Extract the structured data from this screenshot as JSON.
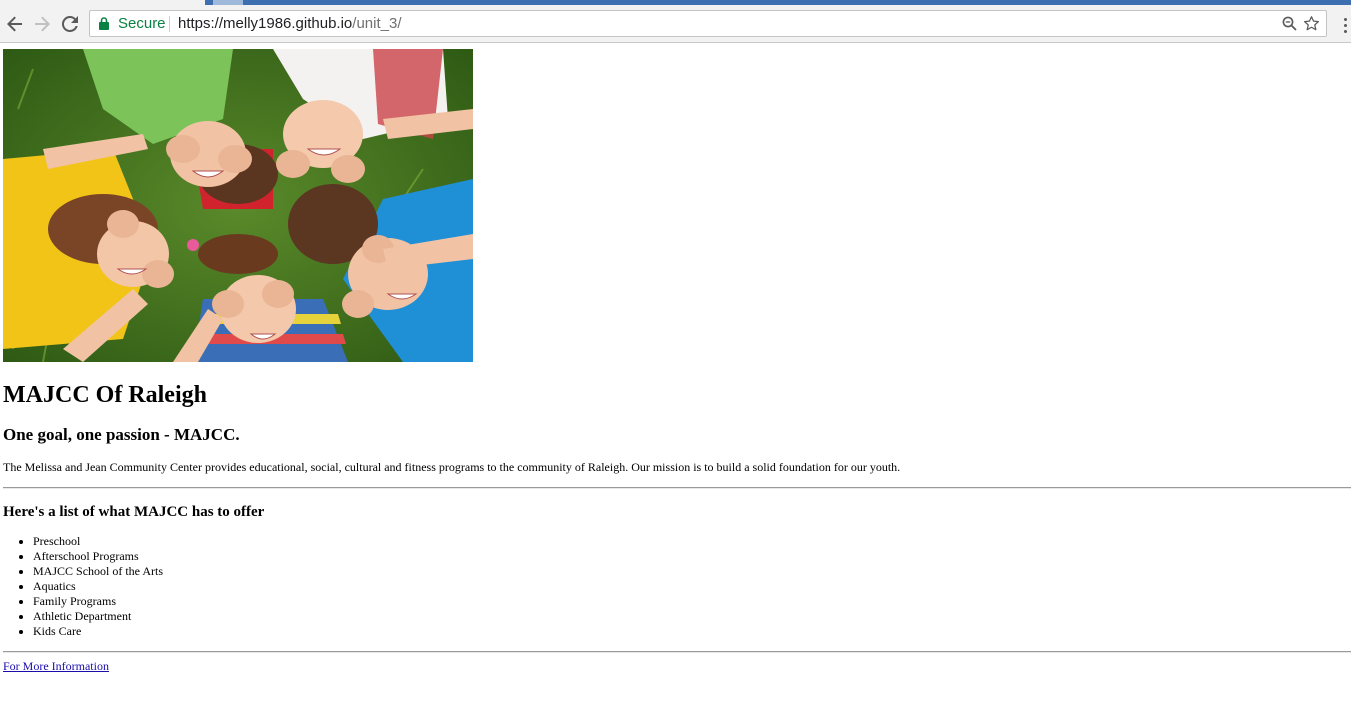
{
  "browser": {
    "secure_label": "Secure",
    "url_host": "https://melly1986.github.io",
    "url_path": "/unit_3/"
  },
  "page": {
    "title": "MAJCC Of Raleigh",
    "tagline": "One goal, one passion - MAJCC.",
    "description": "The Melissa and Jean Community Center provides educational, social, cultural and fitness programs to the community of Raleigh. Our mission is to build a solid foundation for our youth.",
    "offer_heading": "Here's a list of what MAJCC has to offer",
    "offers": [
      "Preschool",
      "Afterschool Programs",
      "MAJCC School of the Arts",
      "Aquatics",
      "Family Programs",
      "Athletic Department",
      "Kids Care"
    ],
    "more_link": "For More Information"
  },
  "colors": {
    "secure_green": "#0b8043",
    "link_blue": "#1a0dab",
    "tab_accent": "#3e6fb0"
  },
  "icons": [
    "back-arrow-icon",
    "forward-arrow-icon",
    "reload-icon",
    "lock-icon",
    "zoom-icon",
    "star-icon",
    "menu-icon"
  ]
}
